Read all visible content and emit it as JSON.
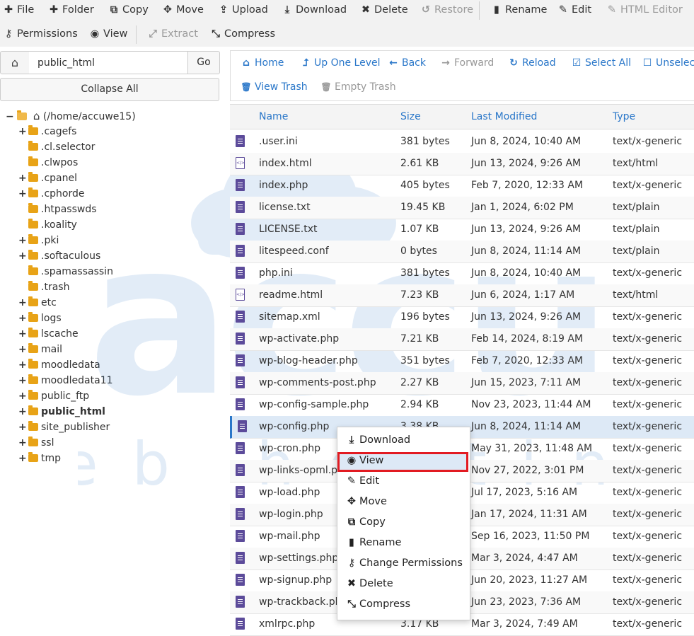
{
  "toolbar": {
    "row1": [
      {
        "icon": "plus-icon",
        "glyph": "✚",
        "label": "File",
        "disabled": false
      },
      {
        "icon": "plus-icon",
        "glyph": "✚",
        "label": "Folder",
        "disabled": false
      },
      {
        "icon": "copy-icon",
        "glyph": "⧉",
        "label": "Copy",
        "disabled": false
      },
      {
        "icon": "move-icon",
        "glyph": "✥",
        "label": "Move",
        "disabled": false
      },
      {
        "icon": "upload-icon",
        "glyph": "⇪",
        "label": "Upload",
        "disabled": false
      },
      {
        "icon": "download-icon",
        "glyph": "⤓",
        "label": "Download",
        "disabled": false
      },
      {
        "icon": "delete-icon",
        "glyph": "✖",
        "label": "Delete",
        "disabled": false
      },
      {
        "icon": "restore-icon",
        "glyph": "↺",
        "label": "Restore",
        "disabled": true
      },
      {
        "icon": "rename-icon",
        "glyph": "▮",
        "label": "Rename",
        "disabled": false
      },
      {
        "icon": "edit-icon",
        "glyph": "✎",
        "label": "Edit",
        "disabled": false
      },
      {
        "icon": "html-editor-icon",
        "glyph": "✎",
        "label": "HTML Editor",
        "disabled": true
      }
    ],
    "row2": [
      {
        "icon": "key-icon",
        "glyph": "⚷",
        "label": "Permissions",
        "disabled": false
      },
      {
        "icon": "eye-icon",
        "glyph": "◉",
        "label": "View",
        "disabled": false
      },
      {
        "icon": "extract-icon",
        "glyph": "⤢",
        "label": "Extract",
        "disabled": true
      },
      {
        "icon": "compress-icon",
        "glyph": "⤡",
        "label": "Compress",
        "disabled": false
      }
    ]
  },
  "path": {
    "value": "public_html",
    "go_label": "Go",
    "collapse_label": "Collapse All"
  },
  "tree": {
    "root": "(/home/accuwe15)",
    "items": [
      {
        "label": ".cagefs",
        "expandable": true,
        "bold": false
      },
      {
        "label": ".cl.selector",
        "expandable": false,
        "bold": false
      },
      {
        "label": ".clwpos",
        "expandable": false,
        "bold": false
      },
      {
        "label": ".cpanel",
        "expandable": true,
        "bold": false
      },
      {
        "label": ".cphorde",
        "expandable": true,
        "bold": false
      },
      {
        "label": ".htpasswds",
        "expandable": false,
        "bold": false
      },
      {
        "label": ".koality",
        "expandable": false,
        "bold": false
      },
      {
        "label": ".pki",
        "expandable": true,
        "bold": false
      },
      {
        "label": ".softaculous",
        "expandable": true,
        "bold": false
      },
      {
        "label": ".spamassassin",
        "expandable": false,
        "bold": false
      },
      {
        "label": ".trash",
        "expandable": false,
        "bold": false
      },
      {
        "label": "etc",
        "expandable": true,
        "bold": false
      },
      {
        "label": "logs",
        "expandable": true,
        "bold": false
      },
      {
        "label": "lscache",
        "expandable": true,
        "bold": false
      },
      {
        "label": "mail",
        "expandable": true,
        "bold": false
      },
      {
        "label": "moodledata",
        "expandable": true,
        "bold": false
      },
      {
        "label": "moodledata11",
        "expandable": true,
        "bold": false
      },
      {
        "label": "public_ftp",
        "expandable": true,
        "bold": false
      },
      {
        "label": "public_html",
        "expandable": true,
        "bold": true
      },
      {
        "label": "site_publisher",
        "expandable": true,
        "bold": false
      },
      {
        "label": "ssl",
        "expandable": true,
        "bold": false
      },
      {
        "label": "tmp",
        "expandable": true,
        "bold": false
      }
    ]
  },
  "right_toolbar": {
    "row1": [
      {
        "icon": "home-icon",
        "glyph": "⌂",
        "label": "Home",
        "disabled": false
      },
      {
        "icon": "up-level-icon",
        "glyph": "⮥",
        "label": "Up One Level",
        "disabled": false
      },
      {
        "icon": "back-icon",
        "glyph": "←",
        "label": "Back",
        "disabled": false
      },
      {
        "icon": "forward-icon",
        "glyph": "→",
        "label": "Forward",
        "disabled": true
      },
      {
        "icon": "reload-icon",
        "glyph": "↻",
        "label": "Reload",
        "disabled": false
      },
      {
        "icon": "select-all-icon",
        "glyph": "☑",
        "label": "Select All",
        "disabled": false
      },
      {
        "icon": "unselect-icon",
        "glyph": "☐",
        "label": "Unselect",
        "disabled": false
      }
    ],
    "row2": [
      {
        "icon": "trash-icon",
        "glyph": "🗑",
        "label": "View Trash",
        "disabled": false
      },
      {
        "icon": "trash-icon",
        "glyph": "🗑",
        "label": "Empty Trash",
        "disabled": true
      }
    ]
  },
  "table": {
    "headers": {
      "name": "Name",
      "size": "Size",
      "modified": "Last Modified",
      "type": "Type"
    },
    "rows": [
      {
        "name": ".user.ini",
        "size": "381 bytes",
        "modified": "Jun 8, 2024, 10:40 AM",
        "type": "text/x-generic",
        "icon": "generic"
      },
      {
        "name": "index.html",
        "size": "2.61 KB",
        "modified": "Jun 13, 2024, 9:26 AM",
        "type": "text/html",
        "icon": "html"
      },
      {
        "name": "index.php",
        "size": "405 bytes",
        "modified": "Feb 7, 2020, 12:33 AM",
        "type": "text/x-generic",
        "icon": "generic"
      },
      {
        "name": "license.txt",
        "size": "19.45 KB",
        "modified": "Jan 1, 2024, 6:02 PM",
        "type": "text/plain",
        "icon": "generic"
      },
      {
        "name": "LICENSE.txt",
        "size": "1.07 KB",
        "modified": "Jun 13, 2024, 9:26 AM",
        "type": "text/plain",
        "icon": "generic"
      },
      {
        "name": "litespeed.conf",
        "size": "0 bytes",
        "modified": "Jun 8, 2024, 11:14 AM",
        "type": "text/plain",
        "icon": "generic"
      },
      {
        "name": "php.ini",
        "size": "381 bytes",
        "modified": "Jun 8, 2024, 10:40 AM",
        "type": "text/x-generic",
        "icon": "generic"
      },
      {
        "name": "readme.html",
        "size": "7.23 KB",
        "modified": "Jun 6, 2024, 1:17 AM",
        "type": "text/html",
        "icon": "html"
      },
      {
        "name": "sitemap.xml",
        "size": "196 bytes",
        "modified": "Jun 13, 2024, 9:26 AM",
        "type": "text/x-generic",
        "icon": "generic"
      },
      {
        "name": "wp-activate.php",
        "size": "7.21 KB",
        "modified": "Feb 14, 2024, 8:19 AM",
        "type": "text/x-generic",
        "icon": "generic"
      },
      {
        "name": "wp-blog-header.php",
        "size": "351 bytes",
        "modified": "Feb 7, 2020, 12:33 AM",
        "type": "text/x-generic",
        "icon": "generic"
      },
      {
        "name": "wp-comments-post.php",
        "size": "2.27 KB",
        "modified": "Jun 15, 2023, 7:11 AM",
        "type": "text/x-generic",
        "icon": "generic"
      },
      {
        "name": "wp-config-sample.php",
        "size": "2.94 KB",
        "modified": "Nov 23, 2023, 11:44 AM",
        "type": "text/x-generic",
        "icon": "generic"
      },
      {
        "name": "wp-config.php",
        "size": "3.38 KB",
        "modified": "Jun 8, 2024, 11:14 AM",
        "type": "text/x-generic",
        "icon": "generic",
        "selected": true
      },
      {
        "name": "wp-cron.php",
        "size": "",
        "modified": "May 31, 2023, 11:48 AM",
        "type": "text/x-generic",
        "icon": "generic"
      },
      {
        "name": "wp-links-opml.php",
        "size": "",
        "modified": "Nov 27, 2022, 3:01 PM",
        "type": "text/x-generic",
        "icon": "generic"
      },
      {
        "name": "wp-load.php",
        "size": "",
        "modified": "Jul 17, 2023, 5:16 AM",
        "type": "text/x-generic",
        "icon": "generic"
      },
      {
        "name": "wp-login.php",
        "size": "",
        "modified": "Jan 17, 2024, 11:31 AM",
        "type": "text/x-generic",
        "icon": "generic"
      },
      {
        "name": "wp-mail.php",
        "size": "",
        "modified": "Sep 16, 2023, 11:50 PM",
        "type": "text/x-generic",
        "icon": "generic"
      },
      {
        "name": "wp-settings.php",
        "size": "",
        "modified": "Mar 3, 2024, 4:47 AM",
        "type": "text/x-generic",
        "icon": "generic"
      },
      {
        "name": "wp-signup.php",
        "size": "",
        "modified": "Jun 20, 2023, 11:27 AM",
        "type": "text/x-generic",
        "icon": "generic"
      },
      {
        "name": "wp-trackback.php",
        "size": "",
        "modified": "Jun 23, 2023, 7:36 AM",
        "type": "text/x-generic",
        "icon": "generic"
      },
      {
        "name": "xmlrpc.php",
        "size": "3.17 KB",
        "modified": "Mar 3, 2024, 7:49 AM",
        "type": "text/x-generic",
        "icon": "generic"
      }
    ]
  },
  "context_menu": {
    "items": [
      {
        "icon": "download-icon",
        "glyph": "⤓",
        "label": "Download"
      },
      {
        "icon": "eye-icon",
        "glyph": "◉",
        "label": "View",
        "highlighted": true
      },
      {
        "icon": "edit-icon",
        "glyph": "✎",
        "label": "Edit"
      },
      {
        "icon": "move-icon",
        "glyph": "✥",
        "label": "Move"
      },
      {
        "icon": "copy-icon",
        "glyph": "⧉",
        "label": "Copy"
      },
      {
        "icon": "rename-icon",
        "glyph": "▮",
        "label": "Rename"
      },
      {
        "icon": "key-icon",
        "glyph": "⚷",
        "label": "Change Permissions"
      },
      {
        "icon": "delete-icon",
        "glyph": "✖",
        "label": "Delete"
      },
      {
        "icon": "compress-icon",
        "glyph": "⤡",
        "label": "Compress"
      }
    ]
  },
  "watermark": {
    "brand": "accu",
    "tagline": "web hosting"
  },
  "colors": {
    "accent": "#2a77c9",
    "folder": "#e8a317",
    "file_icon": "#5c4b9a",
    "highlight_border": "#e21b22",
    "watermark": "#2a77c9"
  }
}
